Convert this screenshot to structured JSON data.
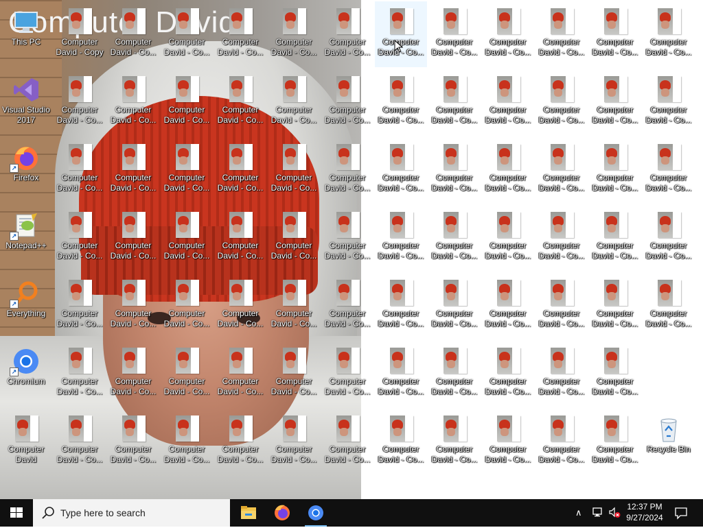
{
  "wallpaper": {
    "overlay_text": "Computer David"
  },
  "system_icons": [
    {
      "name": "this-pc-icon",
      "label": "This PC"
    },
    {
      "name": "visual-studio-icon",
      "label": "Visual Studio 2017"
    },
    {
      "name": "firefox-icon",
      "label": "Firefox"
    },
    {
      "name": "notepad-plus-plus-icon",
      "label": "Notepad++"
    },
    {
      "name": "everything-icon",
      "label": "Everything"
    },
    {
      "name": "chromium-icon",
      "label": "Chromium"
    },
    {
      "name": "computer-david-file-icon",
      "label": "Computer David"
    }
  ],
  "copy_label_first": "Computer David - Copy",
  "copy_label": "Computer David - Co...",
  "recycle_bin_label": "Recycle Bin",
  "taskbar": {
    "search_placeholder": "Type here to search",
    "apps": [
      {
        "name": "file-explorer-taskbar-icon"
      },
      {
        "name": "firefox-taskbar-icon"
      },
      {
        "name": "chromium-taskbar-icon"
      }
    ],
    "clock_time": "12:37 PM",
    "clock_date": "9/27/2024"
  },
  "colors": {
    "taskbar": "#101010",
    "search_bg": "#f3f3f3",
    "accent": "#76b9ed"
  }
}
